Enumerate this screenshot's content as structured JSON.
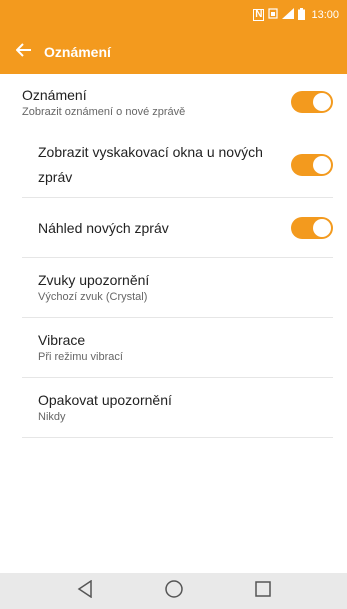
{
  "status_bar": {
    "nfc_label": "N",
    "time": "13:00",
    "icons": [
      "nfc-icon",
      "sim-icon",
      "signal-icon",
      "battery-icon"
    ]
  },
  "app_bar": {
    "title": "Oznámení",
    "back_icon": "arrow-left-icon"
  },
  "settings": [
    {
      "title": "Oznámení",
      "subtitle": "Zobrazit oznámení o nové zprávě",
      "toggle": true
    },
    {
      "title": "Zobrazit vyskakovací okna u nových zpráv",
      "toggle": true
    },
    {
      "title": "Náhled nových zpráv",
      "toggle": true
    },
    {
      "title": "Zvuky upozornění",
      "subtitle": "Výchozí zvuk (Crystal)"
    },
    {
      "title": "Vibrace",
      "subtitle": "Při režimu vibrací"
    },
    {
      "title": "Opakovat upozornění",
      "subtitle": "Nikdy"
    }
  ],
  "nav_bar": {
    "buttons": [
      "back-triangle-icon",
      "home-circle-icon",
      "recents-square-icon"
    ]
  },
  "colors": {
    "accent": "#f39a1e",
    "nav_background": "#e9e9e9"
  }
}
